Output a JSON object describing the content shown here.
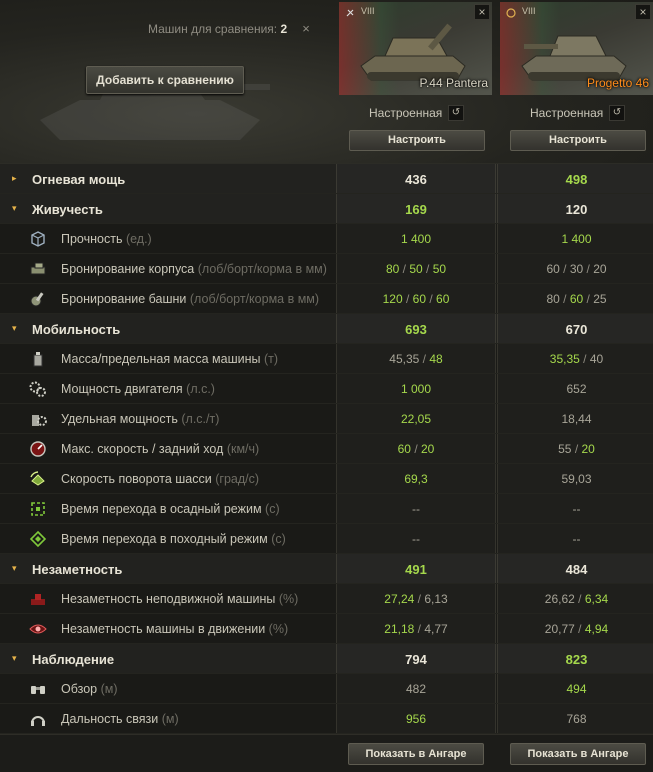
{
  "header": {
    "compare_label": "Машин для сравнения:",
    "compare_count": "2",
    "close_glyph": "×",
    "add_button": "Добавить к сравнению"
  },
  "vehicles": [
    {
      "tier": "VIII",
      "name": "P.44 Pantera",
      "name_color": "#d8d4c4",
      "config_label": "Настроенная",
      "configure_button": "Настроить",
      "hangar_button": "Показать в Ангаре"
    },
    {
      "tier": "VIII",
      "name": "Progetto 46",
      "name_color": "#ff8c1a",
      "config_label": "Настроенная",
      "configure_button": "Настроить",
      "hangar_button": "Показать в Ангаре"
    }
  ],
  "colors": {
    "better": "#a5d84c",
    "accent_orange": "#e6b34a"
  },
  "rows": [
    {
      "type": "group",
      "expanded": false,
      "label": "Огневая мощь",
      "v1": "436",
      "v2": "498",
      "v1_best": false,
      "v2_best": true
    },
    {
      "type": "group",
      "expanded": true,
      "label": "Живучесть",
      "v1": "169",
      "v2": "120",
      "v1_best": true,
      "v2_best": false
    },
    {
      "type": "param",
      "icon": "hitpoints-icon",
      "label": "Прочность",
      "unit": "(ед.)",
      "v1": [
        {
          "t": "1 400",
          "g": true
        }
      ],
      "v2": [
        {
          "t": "1 400",
          "g": true
        }
      ]
    },
    {
      "type": "param",
      "icon": "hull-armor-icon",
      "label": "Бронирование корпуса",
      "unit": "(лоб/борт/корма в мм)",
      "v1": [
        {
          "t": "80",
          "g": true
        },
        {
          "t": "50",
          "g": true
        },
        {
          "t": "50",
          "g": true
        }
      ],
      "v2": [
        {
          "t": "60",
          "g": false
        },
        {
          "t": "30",
          "g": false
        },
        {
          "t": "20",
          "g": false
        }
      ]
    },
    {
      "type": "param",
      "icon": "turret-armor-icon",
      "label": "Бронирование башни",
      "unit": "(лоб/борт/корма в мм)",
      "v1": [
        {
          "t": "120",
          "g": true
        },
        {
          "t": "60",
          "g": true
        },
        {
          "t": "60",
          "g": true
        }
      ],
      "v2": [
        {
          "t": "80",
          "g": false
        },
        {
          "t": "60",
          "g": true
        },
        {
          "t": "25",
          "g": false
        }
      ]
    },
    {
      "type": "group",
      "expanded": true,
      "label": "Мобильность",
      "v1": "693",
      "v2": "670",
      "v1_best": true,
      "v2_best": false
    },
    {
      "type": "param",
      "icon": "weight-icon",
      "label": "Масса/предельная масса машины",
      "unit": "(т)",
      "v1": [
        {
          "t": "45,35",
          "g": false
        },
        {
          "t": "48",
          "g": true
        }
      ],
      "v2": [
        {
          "t": "35,35",
          "g": true
        },
        {
          "t": "40",
          "g": false
        }
      ]
    },
    {
      "type": "param",
      "icon": "engine-power-icon",
      "label": "Мощность двигателя",
      "unit": "(л.с.)",
      "v1": [
        {
          "t": "1 000",
          "g": true
        }
      ],
      "v2": [
        {
          "t": "652",
          "g": false
        }
      ]
    },
    {
      "type": "param",
      "icon": "specific-power-icon",
      "label": "Удельная мощность",
      "unit": "(л.с./т)",
      "v1": [
        {
          "t": "22,05",
          "g": true
        }
      ],
      "v2": [
        {
          "t": "18,44",
          "g": false
        }
      ]
    },
    {
      "type": "param",
      "icon": "speed-icon",
      "label": "Макс. скорость / задний ход",
      "unit": "(км/ч)",
      "v1": [
        {
          "t": "60",
          "g": true
        },
        {
          "t": "20",
          "g": true
        }
      ],
      "v2": [
        {
          "t": "55",
          "g": false
        },
        {
          "t": "20",
          "g": true
        }
      ]
    },
    {
      "type": "param",
      "icon": "traverse-icon",
      "label": "Скорость поворота шасси",
      "unit": "(град/с)",
      "v1": [
        {
          "t": "69,3",
          "g": true
        }
      ],
      "v2": [
        {
          "t": "59,03",
          "g": false
        }
      ]
    },
    {
      "type": "param",
      "icon": "siege-mode-icon",
      "label": "Время перехода в осадный режим",
      "unit": "(с)",
      "v1": [
        {
          "t": "--",
          "g": false
        }
      ],
      "v2": [
        {
          "t": "--",
          "g": false
        }
      ]
    },
    {
      "type": "param",
      "icon": "travel-mode-icon",
      "label": "Время перехода в походный режим",
      "unit": "(с)",
      "v1": [
        {
          "t": "--",
          "g": false
        }
      ],
      "v2": [
        {
          "t": "--",
          "g": false
        }
      ]
    },
    {
      "type": "group",
      "expanded": true,
      "label": "Незаметность",
      "v1": "491",
      "v2": "484",
      "v1_best": true,
      "v2_best": false
    },
    {
      "type": "param",
      "icon": "camo-stationary-icon",
      "label": "Незаметность неподвижной машины",
      "unit": "(%)",
      "v1": [
        {
          "t": "27,24",
          "g": true
        },
        {
          "t": "6,13",
          "g": false
        }
      ],
      "v2": [
        {
          "t": "26,62",
          "g": false
        },
        {
          "t": "6,34",
          "g": true
        }
      ]
    },
    {
      "type": "param",
      "icon": "camo-moving-icon",
      "label": "Незаметность машины в движении",
      "unit": "(%)",
      "v1": [
        {
          "t": "21,18",
          "g": true
        },
        {
          "t": "4,77",
          "g": false
        }
      ],
      "v2": [
        {
          "t": "20,77",
          "g": false
        },
        {
          "t": "4,94",
          "g": true
        }
      ]
    },
    {
      "type": "group",
      "expanded": true,
      "label": "Наблюдение",
      "v1": "794",
      "v2": "823",
      "v1_best": false,
      "v2_best": true
    },
    {
      "type": "param",
      "icon": "view-range-icon",
      "label": "Обзор",
      "unit": "(м)",
      "v1": [
        {
          "t": "482",
          "g": false
        }
      ],
      "v2": [
        {
          "t": "494",
          "g": true
        }
      ]
    },
    {
      "type": "param",
      "icon": "radio-range-icon",
      "label": "Дальность связи",
      "unit": "(м)",
      "v1": [
        {
          "t": "956",
          "g": true
        }
      ],
      "v2": [
        {
          "t": "768",
          "g": false
        }
      ]
    }
  ]
}
